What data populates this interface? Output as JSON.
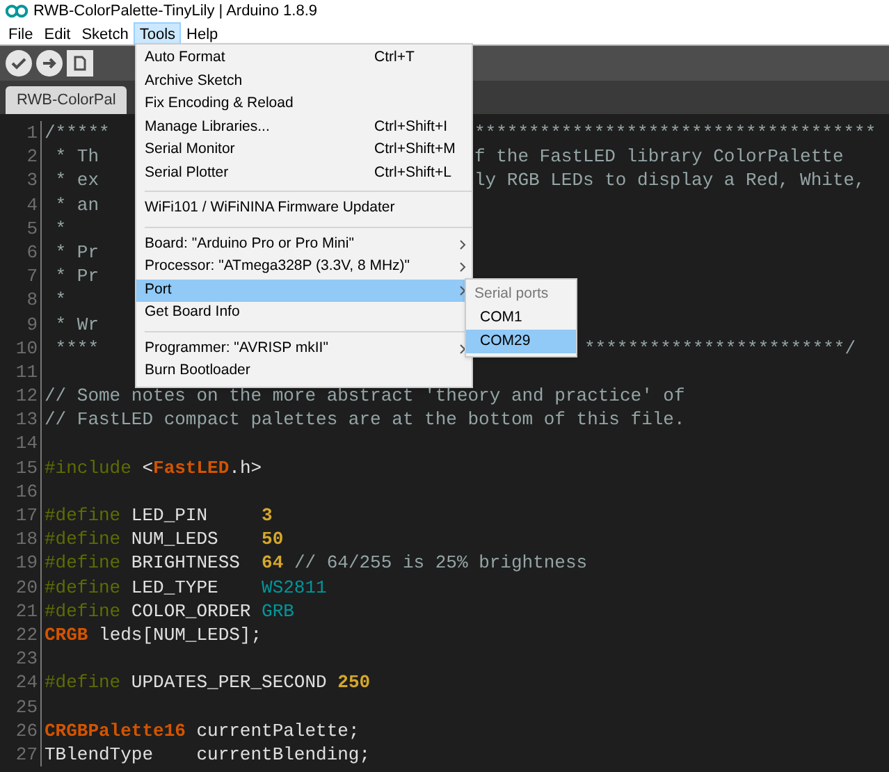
{
  "window": {
    "title": "RWB-ColorPalette-TinyLily | Arduino 1.8.9"
  },
  "menubar": [
    {
      "label": "File",
      "selected": false
    },
    {
      "label": "Edit",
      "selected": false
    },
    {
      "label": "Sketch",
      "selected": false
    },
    {
      "label": "Tools",
      "selected": true
    },
    {
      "label": "Help",
      "selected": false
    }
  ],
  "tab": {
    "label": "RWB-ColorPal"
  },
  "menu": [
    {
      "kind": "item",
      "label": "Auto Format",
      "shortcut": "Ctrl+T"
    },
    {
      "kind": "item",
      "label": "Archive Sketch"
    },
    {
      "kind": "item",
      "label": "Fix Encoding & Reload"
    },
    {
      "kind": "item",
      "label": "Manage Libraries...",
      "shortcut": "Ctrl+Shift+I"
    },
    {
      "kind": "item",
      "label": "Serial Monitor",
      "shortcut": "Ctrl+Shift+M"
    },
    {
      "kind": "item",
      "label": "Serial Plotter",
      "shortcut": "Ctrl+Shift+L"
    },
    {
      "kind": "separator"
    },
    {
      "kind": "item",
      "label": "WiFi101 / WiFiNINA Firmware Updater"
    },
    {
      "kind": "separator"
    },
    {
      "kind": "submenu",
      "label": "Board: \"Arduino Pro or Pro Mini\"",
      "selected": false
    },
    {
      "kind": "submenu",
      "label": "Processor: \"ATmega328P (3.3V, 8 MHz)\"",
      "selected": false
    },
    {
      "kind": "submenu",
      "label": "Port",
      "selected": true
    },
    {
      "kind": "item",
      "label": "Get Board Info"
    },
    {
      "kind": "separator"
    },
    {
      "kind": "submenu",
      "label": "Programmer: \"AVRISP mkII\"",
      "selected": false
    },
    {
      "kind": "item",
      "label": "Burn Bootloader"
    }
  ],
  "submenu": {
    "header": "Serial ports",
    "items": [
      {
        "label": "COM1",
        "selected": false
      },
      {
        "label": "COM29",
        "selected": true
      }
    ]
  },
  "code": [
    {
      "number": "1",
      "left": "/*****",
      "right": "*************************************"
    },
    {
      "number": "2",
      "left": " * Th",
      "right": "f the FastLED library ColorPalette"
    },
    {
      "number": "3",
      "left": " * ex",
      "right": "ly RGB LEDs to display a Red, White,"
    },
    {
      "number": "4",
      "left": " * an"
    },
    {
      "number": "5",
      "left": " *"
    },
    {
      "number": "6",
      "left": " * Pr"
    },
    {
      "number": "7",
      "left": " * Pr"
    },
    {
      "number": "8",
      "left": " *"
    },
    {
      "number": "9",
      "left": " * Wr"
    },
    {
      "number": "10",
      "left": " ****",
      "right": "************************/"
    },
    {
      "number": "11"
    },
    {
      "number": "12",
      "tokens": [
        {
          "kind": "comment",
          "text": "// Some notes on the more abstract 'theory and practice' of"
        }
      ]
    },
    {
      "number": "13",
      "tokens": [
        {
          "kind": "comment",
          "text": "// FastLED compact palettes are at the bottom of this file."
        }
      ]
    },
    {
      "number": "14"
    },
    {
      "number": "15",
      "tokens": [
        {
          "kind": "directive",
          "text": "#include"
        },
        {
          "kind": "plain",
          "text": " <"
        },
        {
          "kind": "type",
          "text": "FastLED"
        },
        {
          "kind": "plain",
          "text": ".h>"
        }
      ]
    },
    {
      "number": "16"
    },
    {
      "number": "17",
      "tokens": [
        {
          "kind": "directive",
          "text": "#define"
        },
        {
          "kind": "plain",
          "text": " LED_PIN     "
        },
        {
          "kind": "number",
          "text": "3"
        }
      ]
    },
    {
      "number": "18",
      "tokens": [
        {
          "kind": "directive",
          "text": "#define"
        },
        {
          "kind": "plain",
          "text": " NUM_LEDS    "
        },
        {
          "kind": "number",
          "text": "50"
        }
      ]
    },
    {
      "number": "19",
      "tokens": [
        {
          "kind": "directive",
          "text": "#define"
        },
        {
          "kind": "plain",
          "text": " BRIGHTNESS  "
        },
        {
          "kind": "number",
          "text": "64"
        },
        {
          "kind": "comment",
          "text": " // 64/255 is 25% brightness"
        }
      ]
    },
    {
      "number": "20",
      "tokens": [
        {
          "kind": "directive",
          "text": "#define"
        },
        {
          "kind": "plain",
          "text": " LED_TYPE    "
        },
        {
          "kind": "constant",
          "text": "WS2811"
        }
      ]
    },
    {
      "number": "21",
      "tokens": [
        {
          "kind": "directive",
          "text": "#define"
        },
        {
          "kind": "plain",
          "text": " COLOR_ORDER "
        },
        {
          "kind": "constant",
          "text": "GRB"
        }
      ]
    },
    {
      "number": "22",
      "tokens": [
        {
          "kind": "type",
          "text": "CRGB"
        },
        {
          "kind": "plain",
          "text": " leds[NUM_LEDS];"
        }
      ]
    },
    {
      "number": "23"
    },
    {
      "number": "24",
      "tokens": [
        {
          "kind": "directive",
          "text": "#define"
        },
        {
          "kind": "plain",
          "text": " UPDATES_PER_SECOND "
        },
        {
          "kind": "number",
          "text": "250"
        }
      ]
    },
    {
      "number": "25"
    },
    {
      "number": "26",
      "tokens": [
        {
          "kind": "type",
          "text": "CRGBPalette16"
        },
        {
          "kind": "plain",
          "text": " currentPalette;"
        }
      ]
    },
    {
      "number": "27",
      "tokens": [
        {
          "kind": "plain",
          "text": "TBlendType    currentBlending;"
        }
      ]
    }
  ]
}
